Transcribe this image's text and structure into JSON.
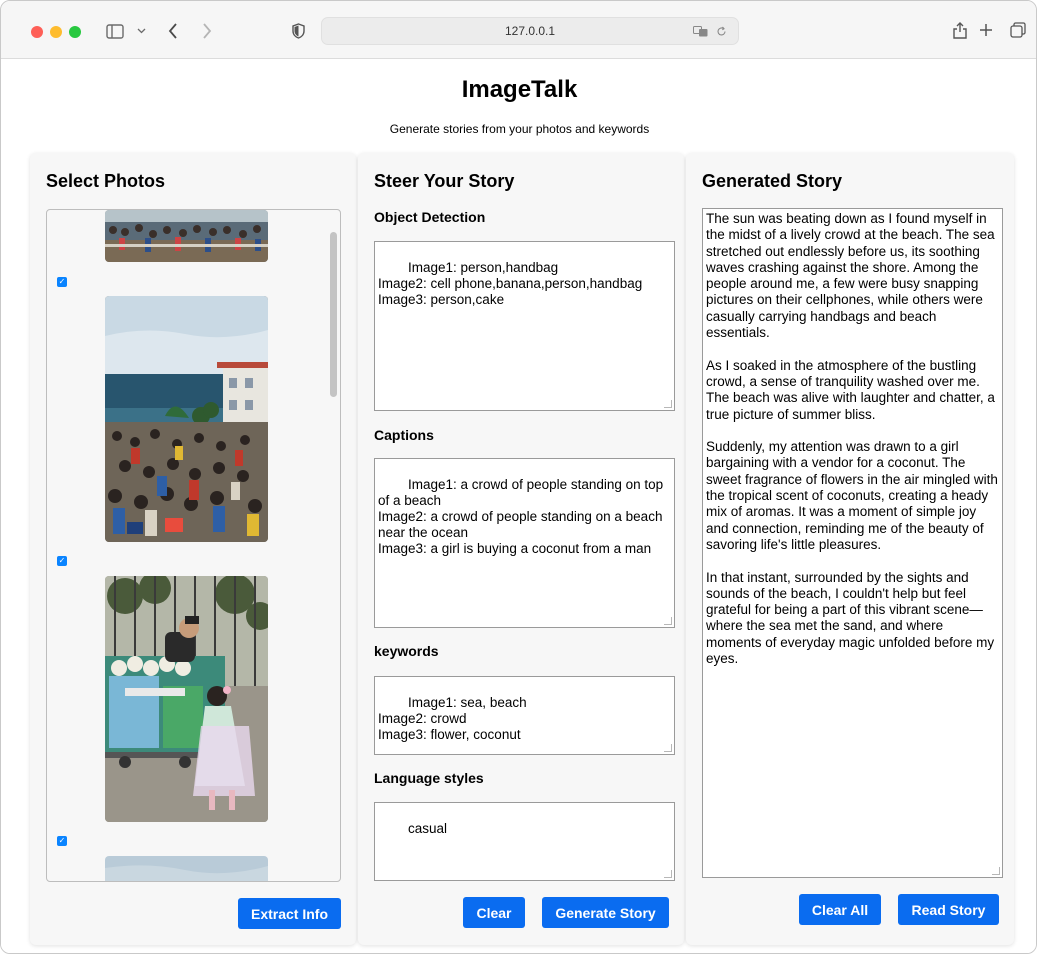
{
  "browser": {
    "url": "127.0.0.1"
  },
  "app": {
    "title": "ImageTalk",
    "subtitle": "Generate stories from your photos and keywords"
  },
  "select_photos": {
    "title": "Select Photos",
    "photos": [
      {
        "checked": true
      },
      {
        "checked": true
      },
      {
        "checked": true
      }
    ],
    "extract_button": "Extract Info"
  },
  "steer": {
    "title": "Steer Your Story",
    "object_detection_label": "Object Detection",
    "object_detection_value": "Image1: person,handbag\nImage2: cell phone,banana,person,handbag\nImage3: person,cake",
    "captions_label": "Captions",
    "captions_value": "Image1: a crowd of people standing on top of a beach\nImage2: a crowd of people standing on a beach near the ocean\nImage3: a girl is buying a coconut from a man",
    "keywords_label": "keywords",
    "keywords_value": "Image1: sea, beach\nImage2: crowd\nImage3: flower, coconut",
    "language_label": "Language styles",
    "language_value": "casual",
    "clear_button": "Clear",
    "generate_button": "Generate Story"
  },
  "generated": {
    "title": "Generated Story",
    "paragraphs": [
      "The sun was beating down as I found myself in the midst of a lively crowd at the beach. The sea stretched out endlessly before us, its soothing waves crashing against the shore. Among the people around me, a few were busy snapping pictures on their cellphones, while others were casually carrying handbags and beach essentials.",
      "As I soaked in the atmosphere of the bustling crowd, a sense of tranquility washed over me. The beach was alive with laughter and chatter, a true picture of summer bliss.",
      "Suddenly, my attention was drawn to a girl bargaining with a vendor for a coconut. The sweet fragrance of flowers in the air mingled with the tropical scent of coconuts, creating a heady mix of aromas. It was a moment of simple joy and connection, reminding me of the beauty of savoring life's little pleasures.",
      "In that instant, surrounded by the sights and sounds of the beach, I couldn't help but feel grateful for being a part of this vibrant scene—where the sea met the sand, and where moments of everyday magic unfolded before my eyes."
    ],
    "clear_all_button": "Clear All",
    "read_button": "Read Story"
  },
  "colors": {
    "button": "#0a6cf0",
    "checkbox": "#0a84ff",
    "panel": "#f7f7f7"
  }
}
